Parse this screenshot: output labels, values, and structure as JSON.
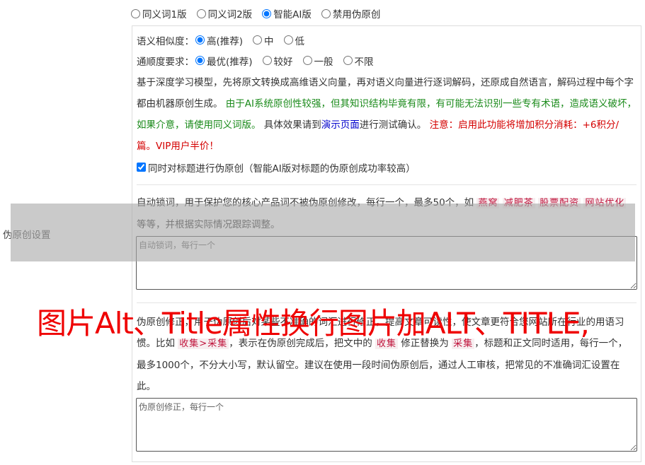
{
  "mode": {
    "options": [
      "同义词1版",
      "同义词2版",
      "智能AI版",
      "禁用伪原创"
    ],
    "selected": "智能AI版"
  },
  "similarity": {
    "label": "语义相似度：",
    "options": [
      "高(推荐)",
      "中",
      "低"
    ],
    "selected": "高(推荐)"
  },
  "fluency": {
    "label": "通顺度要求：",
    "options": [
      "最优(推荐)",
      "较好",
      "一般",
      "不限"
    ],
    "selected": "最优(推荐)"
  },
  "ai_description": {
    "text1": "基于深度学习模型，先将原文转换成高维语义向量，再对语义向量进行逐词解码，还原成自然语言，解码过程中每个字都由机器原创生成。 ",
    "warning_green": "由于AI系统原创性较强，但其知识结构毕竟有限，有可能无法识别一些专有术语，造成语义破坏，如果介意，请使用同义词版。",
    "text2": " 具体效果请到",
    "demo_link": "演示页面",
    "text3": "进行测试确认。 ",
    "notice_red": "注意：启用此功能将增加积分消耗：+6积分/篇。VIP用户半价！"
  },
  "title_checkbox": {
    "label": "同时对标题进行伪原创（智能AI版对标题的伪原创成功率较高）",
    "checked": true
  },
  "side_label": "伪原创设置",
  "lock_words": {
    "text1": "自动锁词，用于保护您的核心产品词不被伪原创修改，每行一个，最多50个，如 ",
    "tags": [
      "燕窝",
      "减肥茶",
      "股票配资",
      "网站优化"
    ],
    "text2": " 等等，并根据实际情况跟踪调整。",
    "placeholder": "自动锁词，每行一个"
  },
  "correction": {
    "text1": "伪原创修正，用于伪原创后对某些不准确的词汇进行修正，提高文章可读性，使文章更符合您网站所在行业的用语习惯。比如 ",
    "example": "收集>采集",
    "text2": "，表示在伪原创完成后，把文中的 ",
    "word_from": "收集",
    "text3": " 修正替换为 ",
    "word_to": "采集",
    "text4": "，标题和正文同时适用，每行一个，最多1000个，不分大小写，默认留空。建议在使用一段时间伪原创后，通过人工审核，把常见的不准确词汇设置在此。",
    "placeholder": "伪原创修正，每行一个"
  },
  "watermark": "图片Alt、Title属性换行图片加ALT、TITLE,"
}
